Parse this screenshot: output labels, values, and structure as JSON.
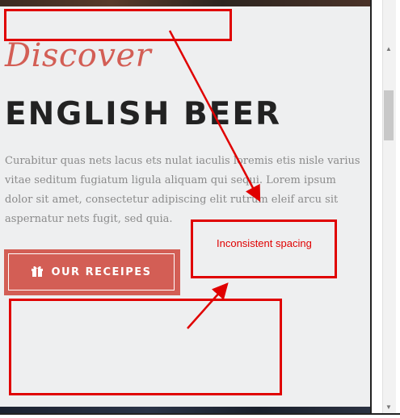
{
  "hero": {
    "script_heading": "Discover",
    "main_heading": "ENGLISH BEER",
    "body": "Curabitur quas nets lacus ets nulat iaculis loremis etis nisle varius vitae seditum fugiatum ligula aliquam qui sequi. Lorem ipsum dolor sit amet, consectetur adipiscing elit rutrum eleif arcu sit aspernatur nets fugit, sed quia.",
    "cta_label": "OUR RECEIPES",
    "cta_icon": "gift-icon"
  },
  "annotation": {
    "note": "Inconsistent spacing",
    "color": "#e00000"
  },
  "colors": {
    "accent": "#d35e55",
    "heading": "#222222",
    "body_text": "#8a8a8a",
    "background": "#eeeff0"
  }
}
